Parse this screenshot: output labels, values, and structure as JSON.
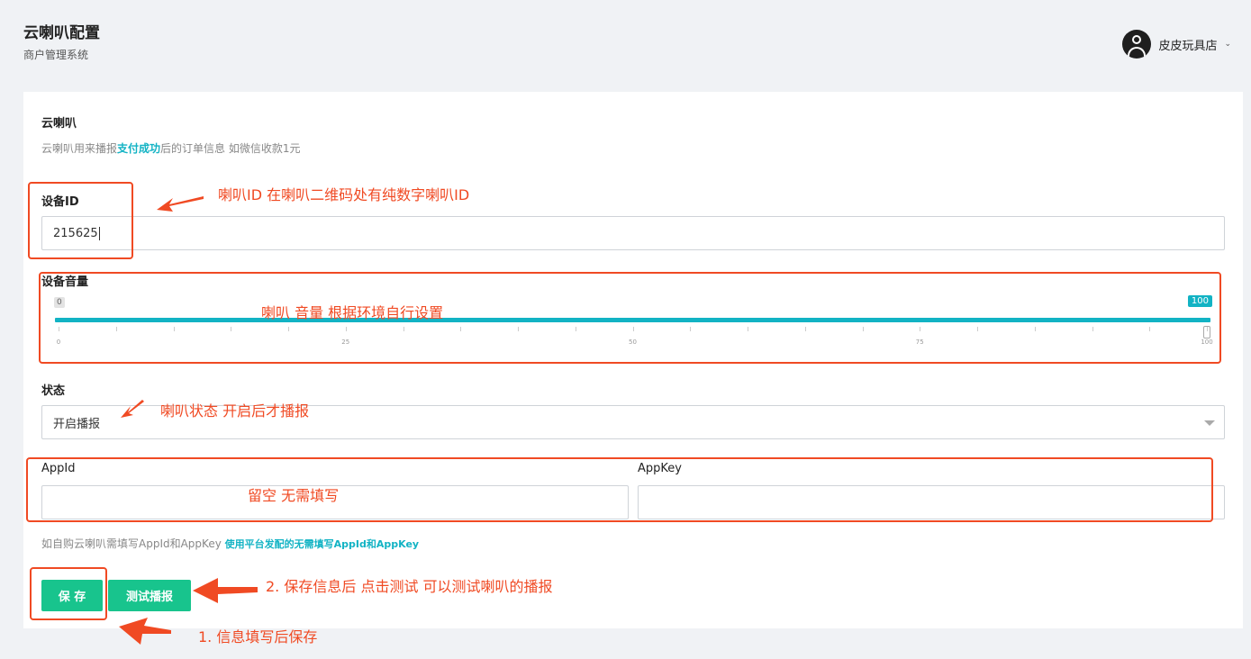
{
  "header": {
    "title": "云喇叭配置",
    "subtitle": "商户管理系统",
    "user_name": "皮皮玩具店"
  },
  "section": {
    "title": "云喇叭",
    "desc_pre": "云喇叭用来播报",
    "desc_highlight": "支付成功",
    "desc_post": "后的订单信息 如微信收款1元"
  },
  "device_id": {
    "label": "设备ID",
    "value": "215625"
  },
  "volume": {
    "label": "设备音量",
    "value": 100,
    "min": 0,
    "max": 100,
    "min_label": "0",
    "max_label": "100",
    "tick_labels": [
      "0",
      "25",
      "50",
      "75",
      "100"
    ]
  },
  "status": {
    "label": "状态",
    "selected": "开启播报"
  },
  "appid": {
    "label": "AppId",
    "value": ""
  },
  "appkey": {
    "label": "AppKey",
    "value": ""
  },
  "help": {
    "text": "如自购云喇叭需填写AppId和AppKey",
    "highlight": "使用平台发配的无需填写AppId和AppKey"
  },
  "buttons": {
    "save": "保 存",
    "test": "测试播报"
  },
  "annotations": {
    "device_id": "喇叭ID  在喇叭二维码处有纯数字喇叭ID",
    "volume": "喇叭 音量   根据环境自行设置",
    "status": "喇叭状态 开启后才播报",
    "app": "留空  无需填写",
    "test": "2. 保存信息后  点击测试 可以测试喇叭的播报",
    "save": "1. 信息填写后保存"
  },
  "colors": {
    "accent": "#12b3c4",
    "button": "#18c48d",
    "annotation": "#f04a23"
  }
}
